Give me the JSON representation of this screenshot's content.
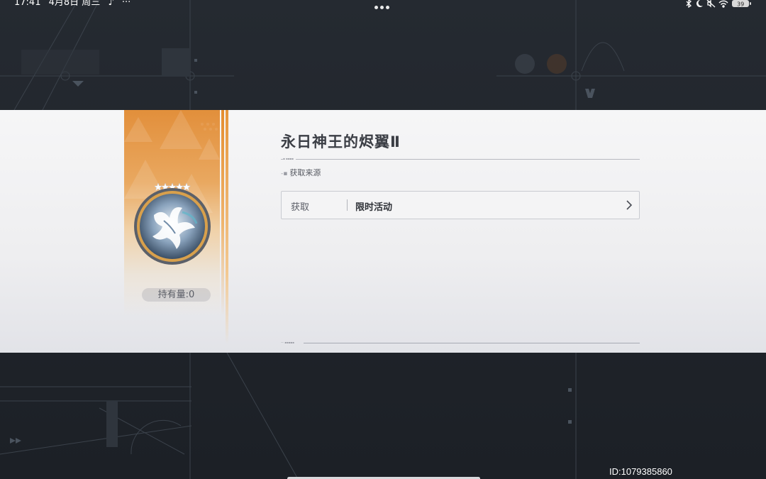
{
  "status_bar": {
    "time": "17:41",
    "date": "4月8日 周三",
    "app_icon": "tiktok-icon",
    "more": "···",
    "battery_level": "39",
    "icons": [
      "bluetooth-icon",
      "moon-icon",
      "mute-icon",
      "wifi-icon",
      "battery-icon"
    ]
  },
  "item": {
    "title": "永日神王的烬翼Ⅱ",
    "rarity_stars": 5,
    "holdings_label": "持有量:0",
    "emblem_icon": "phoenix-emblem-icon"
  },
  "source": {
    "section_label": "获取来源",
    "rows": [
      {
        "kind": "获取",
        "name": "限时活动",
        "chevron_icon": "chevron-right-icon"
      }
    ]
  },
  "footer": {
    "user_id": "ID:1079385860"
  },
  "colors": {
    "accent_orange": "#e28f3b",
    "panel_bg": "#f2f2f4",
    "dark_bg": "#20252b"
  }
}
